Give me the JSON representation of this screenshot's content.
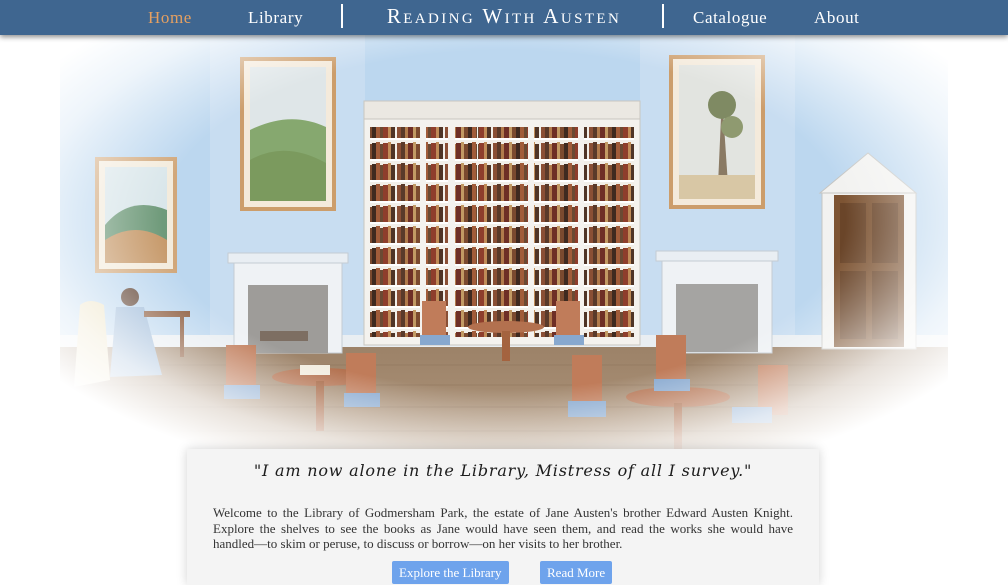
{
  "nav": {
    "home": "Home",
    "library": "Library",
    "title": "Reading With Austen",
    "catalogue": "Catalogue",
    "about": "About"
  },
  "hero": {
    "image_description_icon": "library-room-watercolor-illustration"
  },
  "content": {
    "quote": "\"I am now alone in the Library, Mistress of all I survey.\"",
    "intro": "Welcome to the Library of Godmersham Park, the estate of Jane Austen's brother Edward Austen Knight. Explore the shelves to see the books as Jane would have seen them, and read the works she would have handled—to skim or peruse, to discuss or borrow—on her visits to her brother.",
    "explore_button": "Explore the Library",
    "readmore_button": "Read More"
  },
  "colors": {
    "nav_bg": "#3f6690",
    "nav_active": "#e5a061",
    "button_bg": "#6ea3ec",
    "wall": "#bcd7ef",
    "floor": "#a98e74"
  }
}
